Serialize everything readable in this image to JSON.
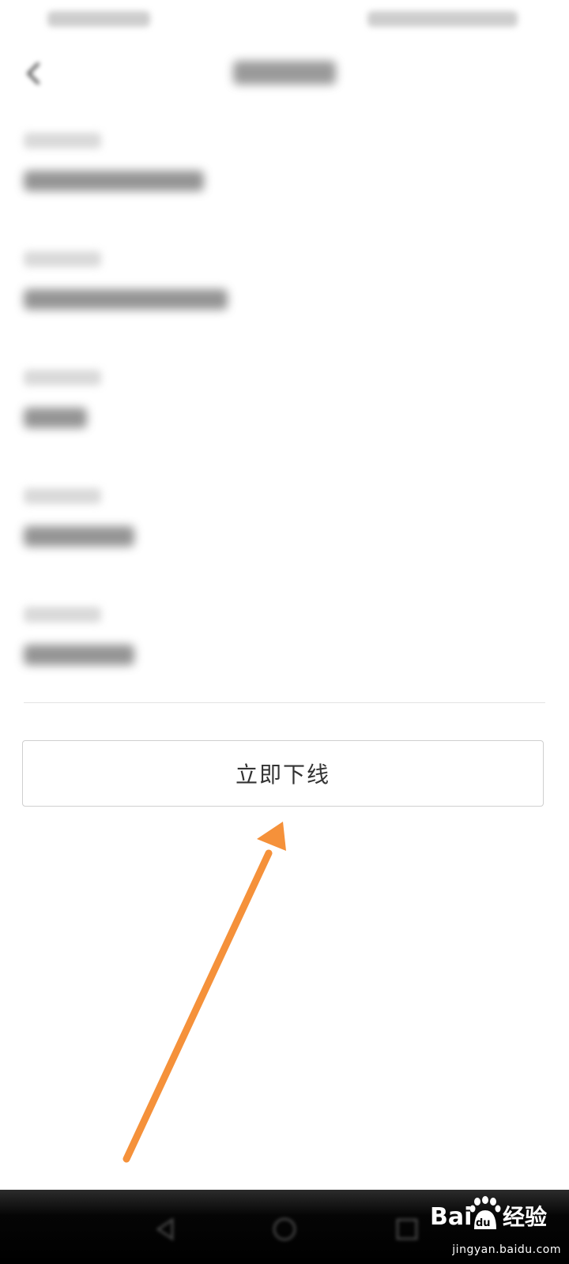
{
  "status_bar": {
    "left_text": "",
    "right_text": ""
  },
  "header": {
    "title": "",
    "back_icon": "chevron-left-icon"
  },
  "info_rows": [
    {
      "label": "",
      "value": ""
    },
    {
      "label": "",
      "value": ""
    },
    {
      "label": "",
      "value": ""
    },
    {
      "label": "",
      "value": ""
    },
    {
      "label": "",
      "value": ""
    }
  ],
  "action_button": {
    "label": "立即下线"
  },
  "annotation": {
    "arrow_color": "#f5913a"
  },
  "nav_bar": {
    "back_icon": "triangle-back-icon",
    "home_icon": "circle-home-icon",
    "recent_icon": "square-recent-icon"
  },
  "watermark": {
    "url": "jingyan.baidu.com"
  },
  "colors": {
    "background": "#ffffff",
    "button_border": "#cfcfcf",
    "button_text": "#333333",
    "nav_bar": "#000000"
  }
}
